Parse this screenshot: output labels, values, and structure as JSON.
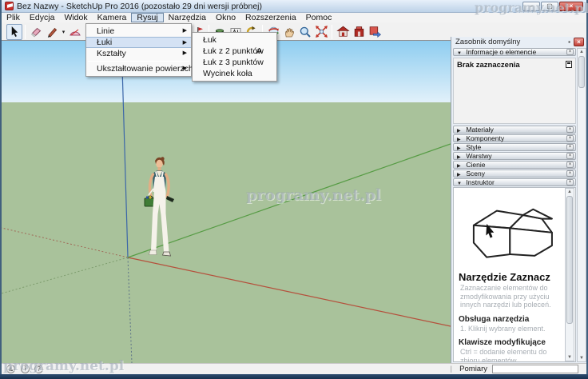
{
  "window": {
    "title": "Bez Nazwy - SketchUp Pro 2016 (pozostało 29 dni wersji próbnej)"
  },
  "watermark": {
    "text": "programy.net.pl"
  },
  "glyphs": {
    "minimize": "–",
    "maximize": "▢",
    "close": "×",
    "submenu_arrow": "▶",
    "expanded": "▼",
    "collapsed": "▶",
    "caret": "▾",
    "pin": "▪",
    "info": "i",
    "question": "?",
    "person": "♟",
    "scroll_up": "▲",
    "scroll_down": "▼"
  },
  "menu_bar": {
    "items": [
      "Plik",
      "Edycja",
      "Widok",
      "Kamera",
      "Rysuj",
      "Narzędzia",
      "Okno",
      "Rozszerzenia",
      "Pomoc"
    ],
    "active": "Rysuj"
  },
  "draw_menu": {
    "linie": "Linie",
    "luki": "Łuki",
    "ksztalty": "Kształty",
    "uksztaltowanie": "Ukształtowanie powierzchni"
  },
  "arcs_submenu": {
    "luk": "Łuk",
    "luk2": "Łuk z 2 punktów",
    "luk2_shortcut": "A",
    "luk3": "Łuk z 3 punktów",
    "wycinek": "Wycinek koła"
  },
  "toolbar": {
    "tools": [
      "select",
      "eraser",
      "line",
      "arc",
      "flag",
      "paint-bucket",
      "text",
      "rotate",
      "orbit",
      "pan",
      "zoom",
      "zoom-extents",
      "3d-warehouse",
      "extension-warehouse",
      "send-to-layout"
    ],
    "active_tool": "select"
  },
  "tray": {
    "title": "Zasobnik domyślny",
    "entity_info_label": "Informacje o elemencie",
    "no_selection": "Brak zaznaczenia",
    "sections": [
      "Materiały",
      "Komponenty",
      "Style",
      "Warstwy",
      "Cienie",
      "Sceny"
    ],
    "instructor_label": "Instruktor",
    "instructor": {
      "heading": "Narzędzie Zaznacz",
      "description": "Zaznaczanie elementów do zmodyfikowania przy użyciu innych narzędzi lub poleceń.",
      "usage_heading": "Obsługa narzędzia",
      "usage_step": "1.    Kliknij wybrany element.",
      "modifiers_heading": "Klawisze modyfikujące",
      "modifiers_text": "Ctrl = dodanie elementu do zbioru elementów zaznaczonych"
    }
  },
  "status_bar": {
    "measurements_label": "Pomiary",
    "measurements_value": ""
  },
  "colors": {
    "sky_top": "#8ecdf0",
    "sky_bottom": "#e2f1fa",
    "ground": "#a9c29b",
    "axis_red": "#b5503c",
    "axis_green": "#579c45",
    "axis_blue": "#3b66a8",
    "close_button_red": "#c0392f"
  }
}
